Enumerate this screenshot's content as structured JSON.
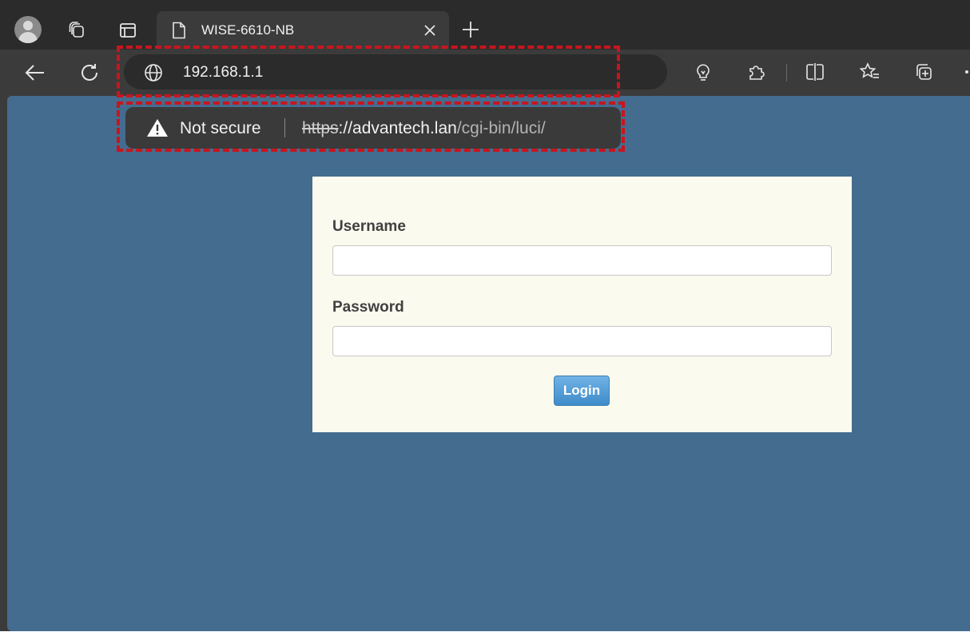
{
  "browser": {
    "tab": {
      "title": "WISE-6610-NB"
    },
    "address_bar": {
      "display_text": "192.168.1.1"
    },
    "security_popup": {
      "status": "Not secure",
      "url_scheme": "https",
      "url_host": "://advantech.lan",
      "url_path": "/cgi-bin/luci/"
    },
    "icons": [
      "profile-icon",
      "workspaces-icon",
      "tab-actions-icon",
      "page-icon",
      "close-icon",
      "new-tab-icon",
      "back-icon",
      "refresh-icon",
      "globe-icon",
      "performance-icon",
      "extensions-icon",
      "split-screen-icon",
      "favorites-icon",
      "collections-icon",
      "warning-icon"
    ]
  },
  "colors": {
    "page_background": "#446c8f",
    "card_background": "#fbfaee",
    "highlight_dash": "#c8151d",
    "login_button": "#4a95d1"
  },
  "login_form": {
    "username_label": "Username",
    "username_value": "",
    "password_label": "Password",
    "password_value": "",
    "login_label": "Login"
  }
}
